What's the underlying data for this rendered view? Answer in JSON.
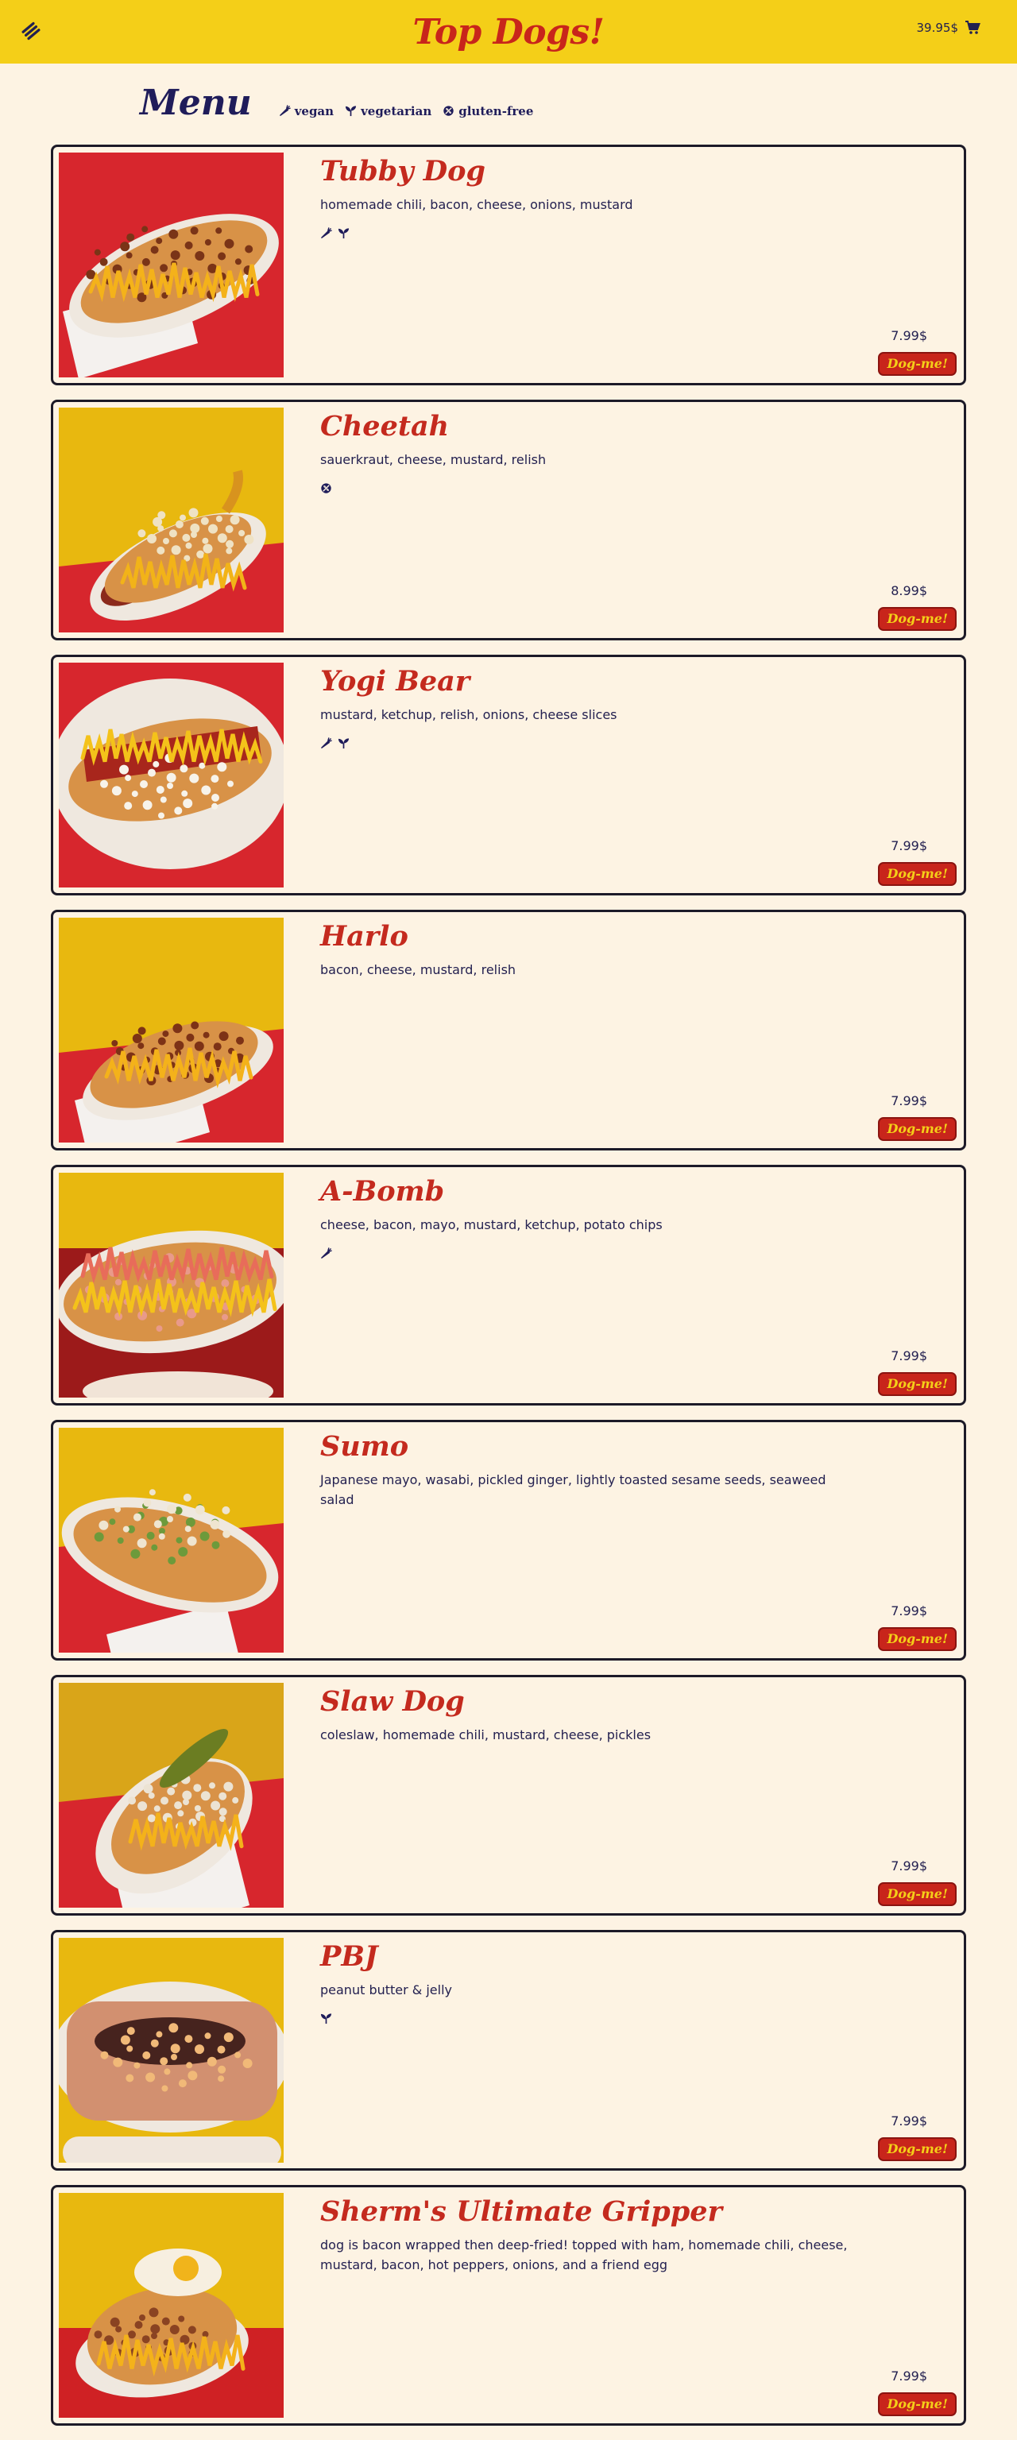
{
  "header": {
    "brand": "Top Dogs!",
    "cart_total": "39.95$",
    "menu_icon": "hamburger-stack-icon",
    "cart_icon": "shopping-cart-icon"
  },
  "menu": {
    "title": "Menu",
    "legend": [
      {
        "icon": "carrot-icon",
        "label": "vegan"
      },
      {
        "icon": "sprout-icon",
        "label": "vegetarian"
      },
      {
        "icon": "no-wheat-icon",
        "label": "gluten-free"
      }
    ]
  },
  "colors": {
    "header_bg": "#f4cf18",
    "page_bg": "#fdf3e3",
    "accent_red": "#c8251b",
    "navy": "#232050"
  },
  "items": [
    {
      "name": "Tubby Dog",
      "ingredients": "homemade chili, bacon, cheese, onions, mustard",
      "diet": [
        "carrot-icon",
        "sprout-icon"
      ],
      "price": "7.99$",
      "button": "Dog-me!",
      "photo": "tray-chili-bacon"
    },
    {
      "name": "Cheetah",
      "ingredients": "sauerkraut, cheese, mustard, relish",
      "diet": [
        "no-wheat-icon"
      ],
      "price": "8.99$",
      "button": "Dog-me!",
      "photo": "yellow-kraut"
    },
    {
      "name": "Yogi Bear",
      "ingredients": "mustard, ketchup, relish, onions, cheese slices",
      "diet": [
        "carrot-icon",
        "sprout-icon"
      ],
      "price": "7.99$",
      "button": "Dog-me!",
      "photo": "red-ketchup"
    },
    {
      "name": "Harlo",
      "ingredients": "bacon, cheese, mustard, relish",
      "diet": [],
      "price": "7.99$",
      "button": "Dog-me!",
      "photo": "yellow-bacon"
    },
    {
      "name": "A-Bomb",
      "ingredients": "cheese, bacon, mayo, mustard, ketchup, potato chips",
      "diet": [
        "carrot-icon"
      ],
      "price": "7.99$",
      "button": "Dog-me!",
      "photo": "loaded-chips"
    },
    {
      "name": "Sumo",
      "ingredients": "Japanese mayo, wasabi, pickled ginger, lightly toasted sesame seeds, seaweed salad",
      "diet": [],
      "price": "7.99$",
      "button": "Dog-me!",
      "photo": "green-seaweed"
    },
    {
      "name": "Slaw Dog",
      "ingredients": "coleslaw, homemade chili, mustard, cheese, pickles",
      "diet": [],
      "price": "7.99$",
      "button": "Dog-me!",
      "photo": "pickle-slaw"
    },
    {
      "name": "PBJ",
      "ingredients": "peanut butter & jelly",
      "diet": [
        "sprout-icon"
      ],
      "price": "7.99$",
      "button": "Dog-me!",
      "photo": "pbj-cubes"
    },
    {
      "name": "Sherm's Ultimate Gripper",
      "ingredients": "dog is bacon wrapped then deep-fried! topped with ham, homemade chili, cheese, mustard, bacon, hot peppers, onions, and a friend egg",
      "diet": [],
      "price": "7.99$",
      "button": "Dog-me!",
      "photo": "fried-egg"
    }
  ]
}
